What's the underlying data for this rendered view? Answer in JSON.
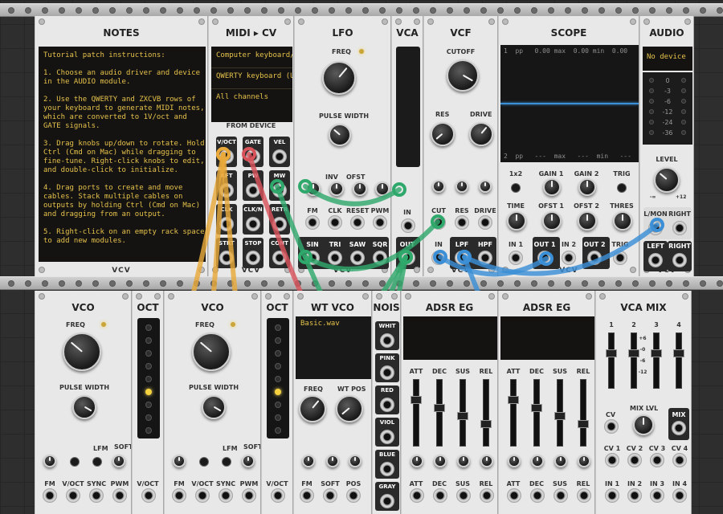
{
  "rack": {
    "brand": "VCV"
  },
  "notes": {
    "title": "NOTES",
    "lines": [
      "Tutorial patch instructions:",
      "",
      "1. Choose an audio driver and device",
      "in the AUDIO module.",
      "",
      "2. Use the QWERTY and ZXCVB rows of",
      "your keyboard to generate MIDI notes,",
      "which are converted to 1V/oct and",
      "GATE signals.",
      "",
      "3. Drag knobs up/down to rotate. Hold",
      "Ctrl (Cmd on Mac) while dragging to",
      "fine-tune. Right-click knobs to edit,",
      "and double-click to initialize.",
      "",
      "4. Drag ports to create and move",
      "cables. Stack multiple cables on",
      "outputs by holding Ctrl (Cmd on Mac)",
      "and dragging from an output.",
      "",
      "5. Right-click on an empty rack space",
      "to add new modules."
    ]
  },
  "midi": {
    "title": "MIDI ▸ CV",
    "driver": "Computer keyboard/m",
    "device": "QWERTY keyboard (US",
    "channel": "All channels",
    "section": "FROM DEVICE",
    "ports": [
      "V/OCT",
      "GATE",
      "VEL",
      "AFT",
      "PW",
      "MW",
      "CLK",
      "CLK/N",
      "RETR",
      "STRT",
      "STOP",
      "CONT"
    ]
  },
  "lfo": {
    "title": "LFO",
    "freq": "FREQ",
    "pw": "PULSE WIDTH",
    "inv": "INV",
    "ofst": "OFST",
    "ins": [
      "FM",
      "CLK",
      "RESET",
      "PWM"
    ],
    "outs": [
      "SIN",
      "TRI",
      "SAW",
      "SQR"
    ]
  },
  "vca": {
    "title": "VCA",
    "in": "IN",
    "out": "OUT"
  },
  "vcf": {
    "title": "VCF",
    "cutoff": "CUTOFF",
    "res": "RES",
    "drive": "DRIVE",
    "mods": [
      "CUT",
      "RES",
      "DRIVE"
    ],
    "io": [
      "IN",
      "LPF",
      "HPF"
    ]
  },
  "scope": {
    "title": "SCOPE",
    "stat1": "1  pp   0.00 max  0.00 min  0.00",
    "stat2": "2  pp   ---  max   ---  min   ---",
    "ctl": [
      "1x2",
      "GAIN 1",
      "GAIN 2",
      "TRIG",
      "TIME",
      "OFST 1",
      "OFST 2",
      "THRES"
    ],
    "ports": [
      "IN 1",
      "OUT 1",
      "IN 2",
      "OUT 2",
      "TRIG"
    ]
  },
  "audio": {
    "title": "AUDIO",
    "device": "No device",
    "meter": [
      "0",
      "-3",
      "-6",
      "-12",
      "-24",
      "-36"
    ],
    "level": "LEVEL",
    "min": "-∞",
    "max": "+12",
    "ports": [
      "L/MON",
      "RIGHT",
      "LEFT",
      "RIGHT"
    ]
  },
  "vco1": {
    "title": "VCO",
    "freq": "FREQ",
    "pw": "PULSE WIDTH",
    "lfm": "LFM",
    "soft": "SOFT",
    "ins": [
      "FM",
      "V/OCT",
      "SYNC",
      "PWM"
    ]
  },
  "oct1": {
    "title": "OCT",
    "port": "V/OCT"
  },
  "vco2": {
    "title": "VCO",
    "freq": "FREQ",
    "pw": "PULSE WIDTH",
    "lfm": "LFM",
    "soft": "SOFT",
    "ins": [
      "FM",
      "V/OCT",
      "SYNC",
      "PWM"
    ]
  },
  "oct2": {
    "title": "OCT",
    "port": "V/OCT"
  },
  "wtvco": {
    "title": "WT VCO",
    "file": "Basic.wav",
    "freq": "FREQ",
    "wtpos": "WT POS",
    "ins": [
      "FM",
      "SOFT",
      "POS"
    ]
  },
  "noise": {
    "title": "NOIS",
    "outs": [
      "WHIT",
      "PINK",
      "RED",
      "VIOL",
      "BLUE",
      "GRAY"
    ]
  },
  "adsr1": {
    "title": "ADSR EG",
    "sliders": [
      "ATT",
      "DEC",
      "SUS",
      "REL"
    ]
  },
  "adsr2": {
    "title": "ADSR EG",
    "sliders": [
      "ATT",
      "DEC",
      "SUS",
      "REL"
    ]
  },
  "vcamix": {
    "title": "VCA MIX",
    "ch": [
      "1",
      "2",
      "3",
      "4"
    ],
    "scale": [
      "+6",
      "-0",
      "-6",
      "-12"
    ],
    "mixlvl": "MIX LVL",
    "cv": "CV",
    "mix": "MIX",
    "cvs": [
      "CV 1",
      "CV 2",
      "CV 3",
      "CV 4"
    ],
    "ins": [
      "IN 1",
      "IN 2",
      "IN 3",
      "IN 4"
    ],
    "min": "-∞",
    "max": "+6"
  },
  "cable_colors": {
    "yellow": "#e9a93a",
    "red": "#d9535b",
    "green": "#2fa86b",
    "blue": "#3b8fd6"
  }
}
